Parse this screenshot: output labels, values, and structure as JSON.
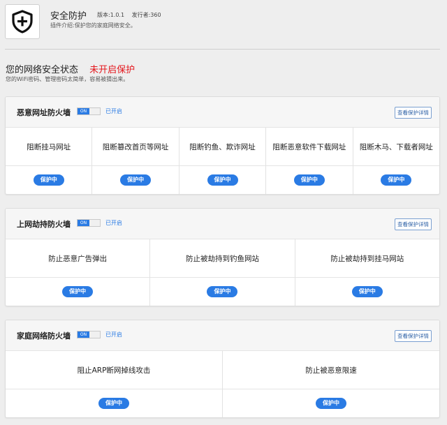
{
  "header": {
    "icon": "shield-plus-icon",
    "title": "安全防护",
    "version": "版本:1.0.1",
    "publisher": "发行者:360",
    "description": "插件介绍:保护您的家庭网络安全。"
  },
  "status": {
    "title": "您的网络安全状态",
    "state": "未开启保护",
    "subtitle": "您的WiFi密码、管理密码太简单，容易被猜出来。"
  },
  "colors": {
    "accent": "#2a7be4",
    "danger": "#e4161c"
  },
  "cards": [
    {
      "title": "恶意网址防火墙",
      "toggle": "ON",
      "status": "已开启",
      "detail_label": "查看保护详情",
      "items": [
        {
          "label": "阻断挂马网址",
          "badge": "保护中"
        },
        {
          "label": "阻断篡改首页等网址",
          "badge": "保护中"
        },
        {
          "label": "阻断钓鱼、欺诈网址",
          "badge": "保护中"
        },
        {
          "label": "阻断恶意软件下载网址",
          "badge": "保护中"
        },
        {
          "label": "阻断木马、下载者网址",
          "badge": "保护中"
        }
      ]
    },
    {
      "title": "上网劫持防火墙",
      "toggle": "ON",
      "status": "已开启",
      "detail_label": "查看保护详情",
      "items": [
        {
          "label": "防止恶意广告弹出",
          "badge": "保护中"
        },
        {
          "label": "防止被劫持到钓鱼网站",
          "badge": "保护中"
        },
        {
          "label": "防止被劫持到挂马网站",
          "badge": "保护中"
        }
      ]
    },
    {
      "title": "家庭网络防火墙",
      "toggle": "ON",
      "status": "已开启",
      "detail_label": "查看保护详情",
      "items": [
        {
          "label": "阻止ARP断网掉线攻击",
          "badge": "保护中"
        },
        {
          "label": "防止被恶意限速",
          "badge": "保护中"
        }
      ]
    }
  ]
}
